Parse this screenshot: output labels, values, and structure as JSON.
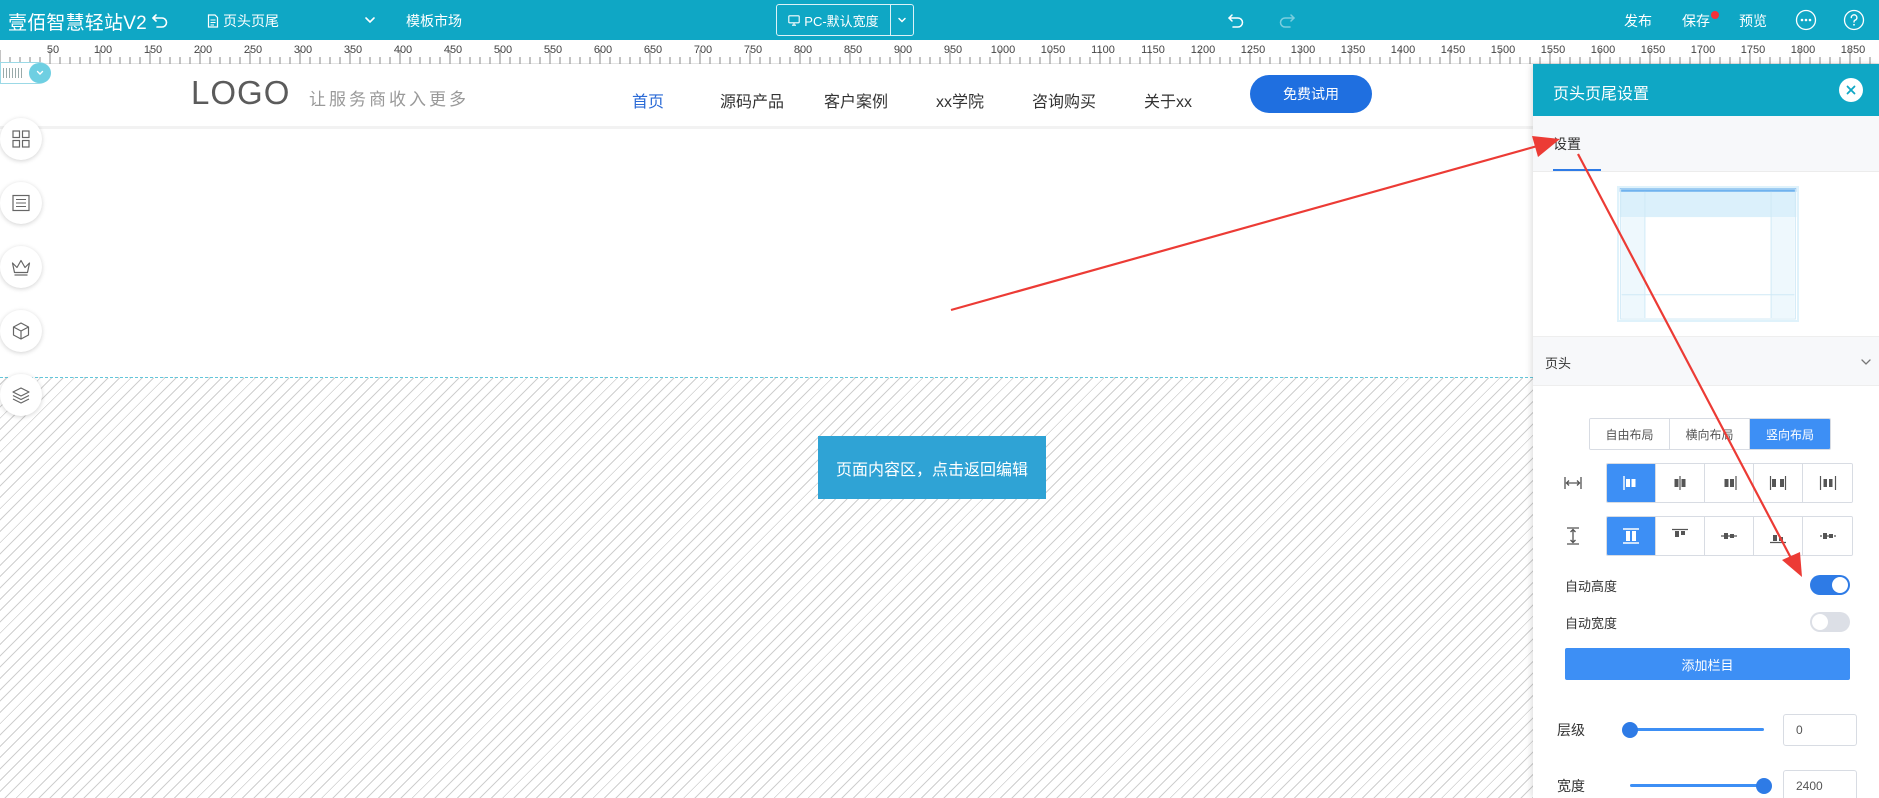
{
  "topbar": {
    "brand": "壹佰智慧轻站V2",
    "page_select": "页头页尾",
    "template_market": "模板市场",
    "device_mode": "PC-默认宽度",
    "publish": "发布",
    "save": "保存",
    "preview": "预览"
  },
  "ruler": {
    "labels": [
      "50",
      "100",
      "150",
      "200",
      "250",
      "300",
      "350",
      "400",
      "450",
      "500",
      "550",
      "600",
      "650",
      "700",
      "750",
      "800",
      "850",
      "900",
      "950",
      "1000",
      "1050",
      "1100",
      "1150",
      "1200",
      "1250",
      "1300",
      "1350",
      "1400",
      "1450",
      "1500",
      "1550",
      "1600",
      "1650",
      "1700",
      "1750",
      "1800",
      "1850"
    ]
  },
  "site_header": {
    "logo": "LOGO",
    "slogan": "让服务商收入更多",
    "nav": [
      "首页",
      "源码产品",
      "客户案例",
      "xx学院",
      "咨询购买",
      "关于xx"
    ],
    "cta": "免费试用"
  },
  "content_area": {
    "back_button": "页面内容区，点击返回编辑"
  },
  "panel": {
    "title": "页头页尾设置",
    "tab": "设置",
    "section_title": "页头",
    "layout_options": [
      "自由布局",
      "横向布局",
      "竖向布局"
    ],
    "layout_selected": "竖向布局",
    "auto_height_label": "自动高度",
    "auto_height": true,
    "auto_width_label": "自动宽度",
    "auto_width": false,
    "add_column": "添加栏目",
    "z_index_label": "层级",
    "z_index_value": "0",
    "z_index_fraction": 0.0,
    "width_label": "宽度",
    "width_value": "2400",
    "width_fraction": 1.0
  },
  "colors": {
    "topbar": "#0fa7c5",
    "accent": "#3d8ff5",
    "cta": "#1f6fe0",
    "content_button": "#2fa3d5",
    "annotation_arrow": "#ec3b35"
  },
  "icons": [
    "undo-icon",
    "document-icon",
    "chevron-down-icon",
    "monitor-icon",
    "redo-icon",
    "more-icon",
    "help-icon",
    "grid-icon",
    "list-icon",
    "crown-icon",
    "cube-icon",
    "layers-icon",
    "close-icon"
  ]
}
